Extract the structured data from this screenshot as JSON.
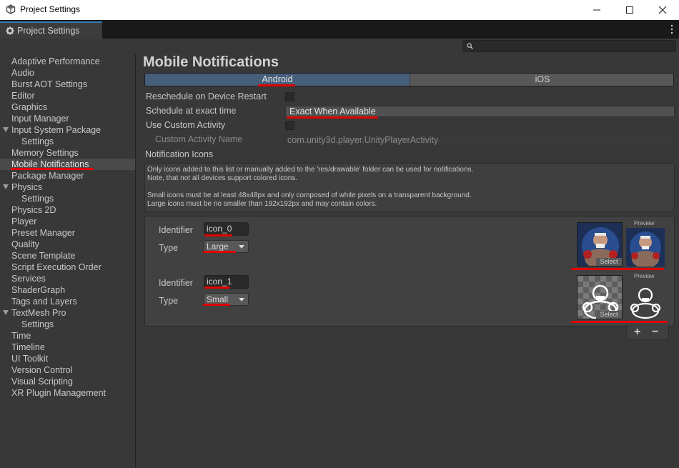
{
  "window": {
    "title": "Project Settings"
  },
  "tab": {
    "label": "Project Settings"
  },
  "search": {
    "placeholder": ""
  },
  "sidebar": {
    "items": [
      {
        "label": "Adaptive Performance",
        "indent": 0,
        "foldout": false
      },
      {
        "label": "Audio",
        "indent": 0,
        "foldout": false
      },
      {
        "label": "Burst AOT Settings",
        "indent": 0,
        "foldout": false
      },
      {
        "label": "Editor",
        "indent": 0,
        "foldout": false
      },
      {
        "label": "Graphics",
        "indent": 0,
        "foldout": false
      },
      {
        "label": "Input Manager",
        "indent": 0,
        "foldout": false
      },
      {
        "label": "Input System Package",
        "indent": 0,
        "foldout": true
      },
      {
        "label": "Settings",
        "indent": 1,
        "foldout": false
      },
      {
        "label": "Memory Settings",
        "indent": 0,
        "foldout": false
      },
      {
        "label": "Mobile Notifications",
        "indent": 0,
        "foldout": false,
        "selected": true
      },
      {
        "label": "Package Manager",
        "indent": 0,
        "foldout": false
      },
      {
        "label": "Physics",
        "indent": 0,
        "foldout": true
      },
      {
        "label": "Settings",
        "indent": 1,
        "foldout": false
      },
      {
        "label": "Physics 2D",
        "indent": 0,
        "foldout": false
      },
      {
        "label": "Player",
        "indent": 0,
        "foldout": false
      },
      {
        "label": "Preset Manager",
        "indent": 0,
        "foldout": false
      },
      {
        "label": "Quality",
        "indent": 0,
        "foldout": false
      },
      {
        "label": "Scene Template",
        "indent": 0,
        "foldout": false
      },
      {
        "label": "Script Execution Order",
        "indent": 0,
        "foldout": false
      },
      {
        "label": "Services",
        "indent": 0,
        "foldout": false
      },
      {
        "label": "ShaderGraph",
        "indent": 0,
        "foldout": false
      },
      {
        "label": "Tags and Layers",
        "indent": 0,
        "foldout": false
      },
      {
        "label": "TextMesh Pro",
        "indent": 0,
        "foldout": true
      },
      {
        "label": "Settings",
        "indent": 1,
        "foldout": false
      },
      {
        "label": "Time",
        "indent": 0,
        "foldout": false
      },
      {
        "label": "Timeline",
        "indent": 0,
        "foldout": false
      },
      {
        "label": "UI Toolkit",
        "indent": 0,
        "foldout": false
      },
      {
        "label": "Version Control",
        "indent": 0,
        "foldout": false
      },
      {
        "label": "Visual Scripting",
        "indent": 0,
        "foldout": false
      },
      {
        "label": "XR Plugin Management",
        "indent": 0,
        "foldout": false
      }
    ]
  },
  "main": {
    "heading": "Mobile Notifications",
    "platform_tabs": {
      "android": "Android",
      "ios": "iOS",
      "selected": "Android"
    },
    "settings": {
      "reschedule_label": "Reschedule on Device Restart",
      "reschedule_checked": false,
      "exact_time_label": "Schedule at exact time",
      "exact_time_value": "Exact When Available",
      "custom_activity_label": "Use Custom Activity",
      "custom_activity_checked": false,
      "activity_name_label": "Custom Activity Name",
      "activity_name_value": "com.unity3d.player.UnityPlayerActivity"
    },
    "notification_icons": {
      "label": "Notification Icons",
      "help": [
        "Only icons added to this list or manually added to the 'res/drawable' folder can be used for notifications.",
        "Note, that not all devices support colored icons.",
        "",
        "Small icons must be at least 48x48px and only composed of white pixels on a transparent background.",
        "Large icons must be no smaller than 192x192px and may contain colors."
      ],
      "identifier_label": "Identifier",
      "type_label": "Type",
      "select_label": "Select",
      "preview_label": "Preview",
      "icons": [
        {
          "identifier": "icon_0",
          "type": "Large"
        },
        {
          "identifier": "icon_1",
          "type": "Small"
        }
      ],
      "add_label": "+",
      "remove_label": "−"
    }
  },
  "colors": {
    "selected_tab": "#46607c",
    "annotation": "#e00000",
    "tab_accent": "#3a79bb"
  }
}
